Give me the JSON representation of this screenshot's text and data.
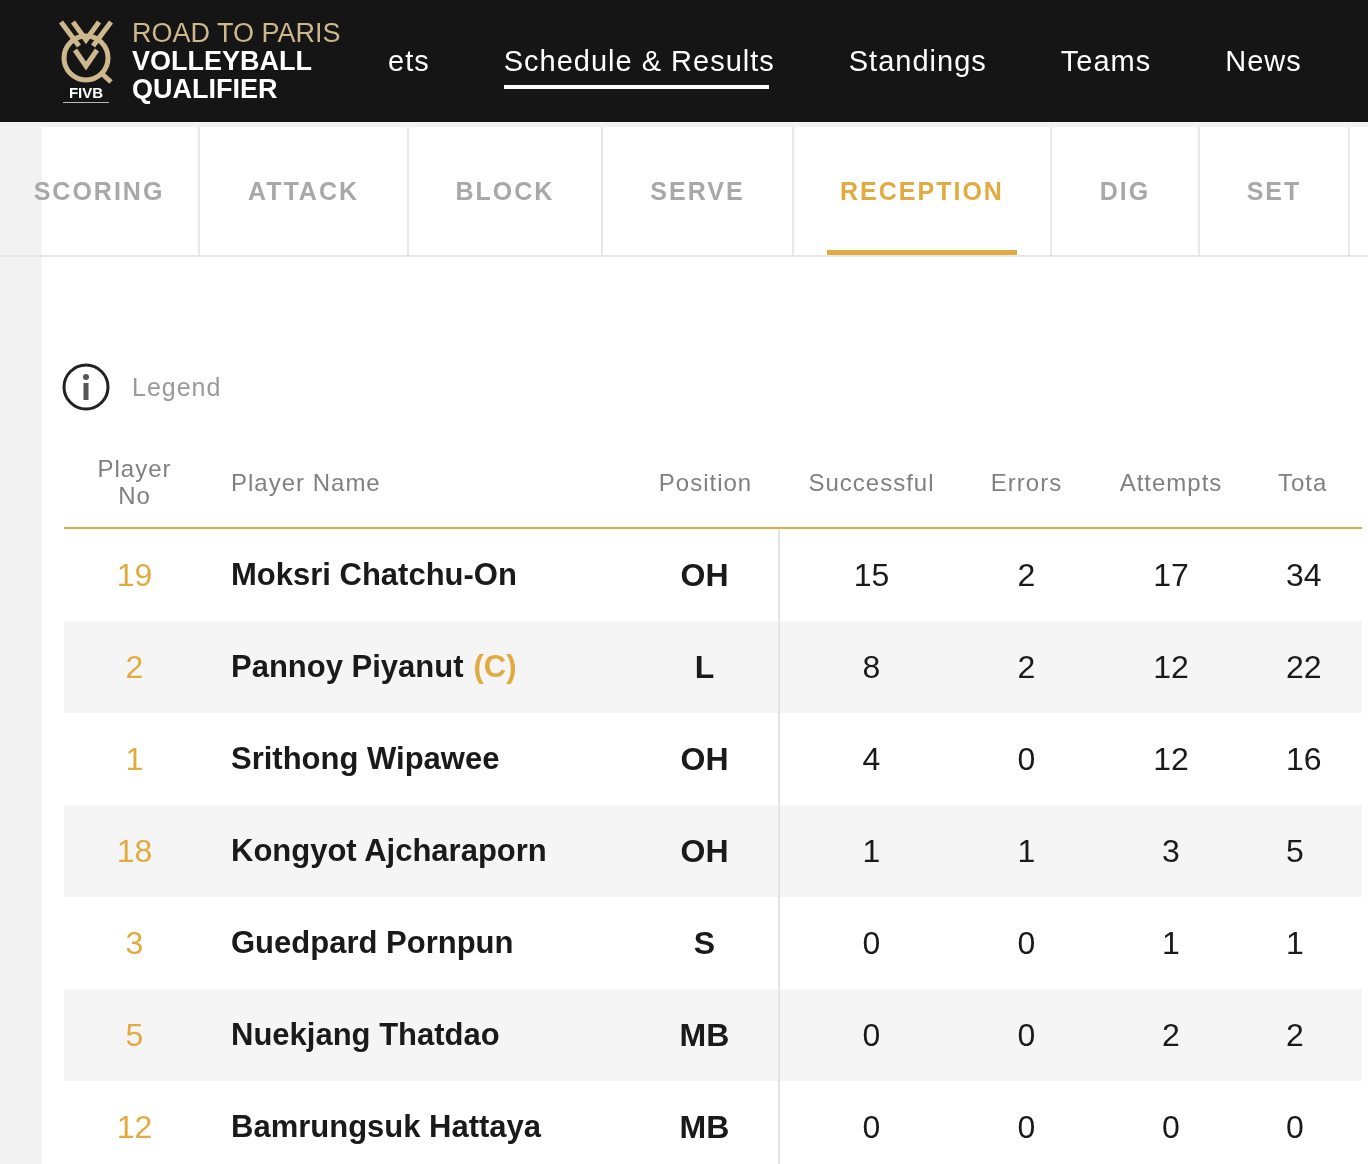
{
  "header": {
    "logo": {
      "line_1": "ROAD TO PARIS",
      "line_2": "VOLLEYBALL",
      "line_3": "QUALIFIER",
      "badge": "FIVB"
    },
    "nav": [
      {
        "label": "ets",
        "selected": false
      },
      {
        "label": "Schedule & Results",
        "selected": true
      },
      {
        "label": "Standings",
        "selected": false
      },
      {
        "label": "Teams",
        "selected": false
      },
      {
        "label": "News",
        "selected": false
      }
    ]
  },
  "tabs": [
    {
      "label": "SCORING",
      "selected": false
    },
    {
      "label": "ATTACK",
      "selected": false
    },
    {
      "label": "BLOCK",
      "selected": false
    },
    {
      "label": "SERVE",
      "selected": false
    },
    {
      "label": "RECEPTION",
      "selected": true
    },
    {
      "label": "DIG",
      "selected": false
    },
    {
      "label": "SET",
      "selected": false
    }
  ],
  "legend": {
    "label": "Legend"
  },
  "table": {
    "columns": [
      "Player No",
      "Player Name",
      "Position",
      "Successful",
      "Errors",
      "Attempts",
      "Tota"
    ],
    "rows": [
      {
        "no": "19",
        "name": "Moksri Chatchu-On",
        "position": "OH",
        "successful": "15",
        "errors": "2",
        "attempts": "17",
        "total": "34"
      },
      {
        "no": "2",
        "name": "Pannoy Piyanut",
        "captain": "(C)",
        "position": "L",
        "successful": "8",
        "errors": "2",
        "attempts": "12",
        "total": "22"
      },
      {
        "no": "1",
        "name": "Srithong Wipawee",
        "position": "OH",
        "successful": "4",
        "errors": "0",
        "attempts": "12",
        "total": "16"
      },
      {
        "no": "18",
        "name": "Kongyot Ajcharaporn",
        "position": "OH",
        "successful": "1",
        "errors": "1",
        "attempts": "3",
        "total": "5"
      },
      {
        "no": "3",
        "name": "Guedpard Pornpun",
        "position": "S",
        "successful": "0",
        "errors": "0",
        "attempts": "1",
        "total": "1"
      },
      {
        "no": "5",
        "name": "Nuekjang Thatdao",
        "position": "MB",
        "successful": "0",
        "errors": "0",
        "attempts": "2",
        "total": "2"
      },
      {
        "no": "12",
        "name": "Bamrungsuk Hattaya",
        "position": "MB",
        "successful": "0",
        "errors": "0",
        "attempts": "0",
        "total": "0"
      }
    ]
  }
}
